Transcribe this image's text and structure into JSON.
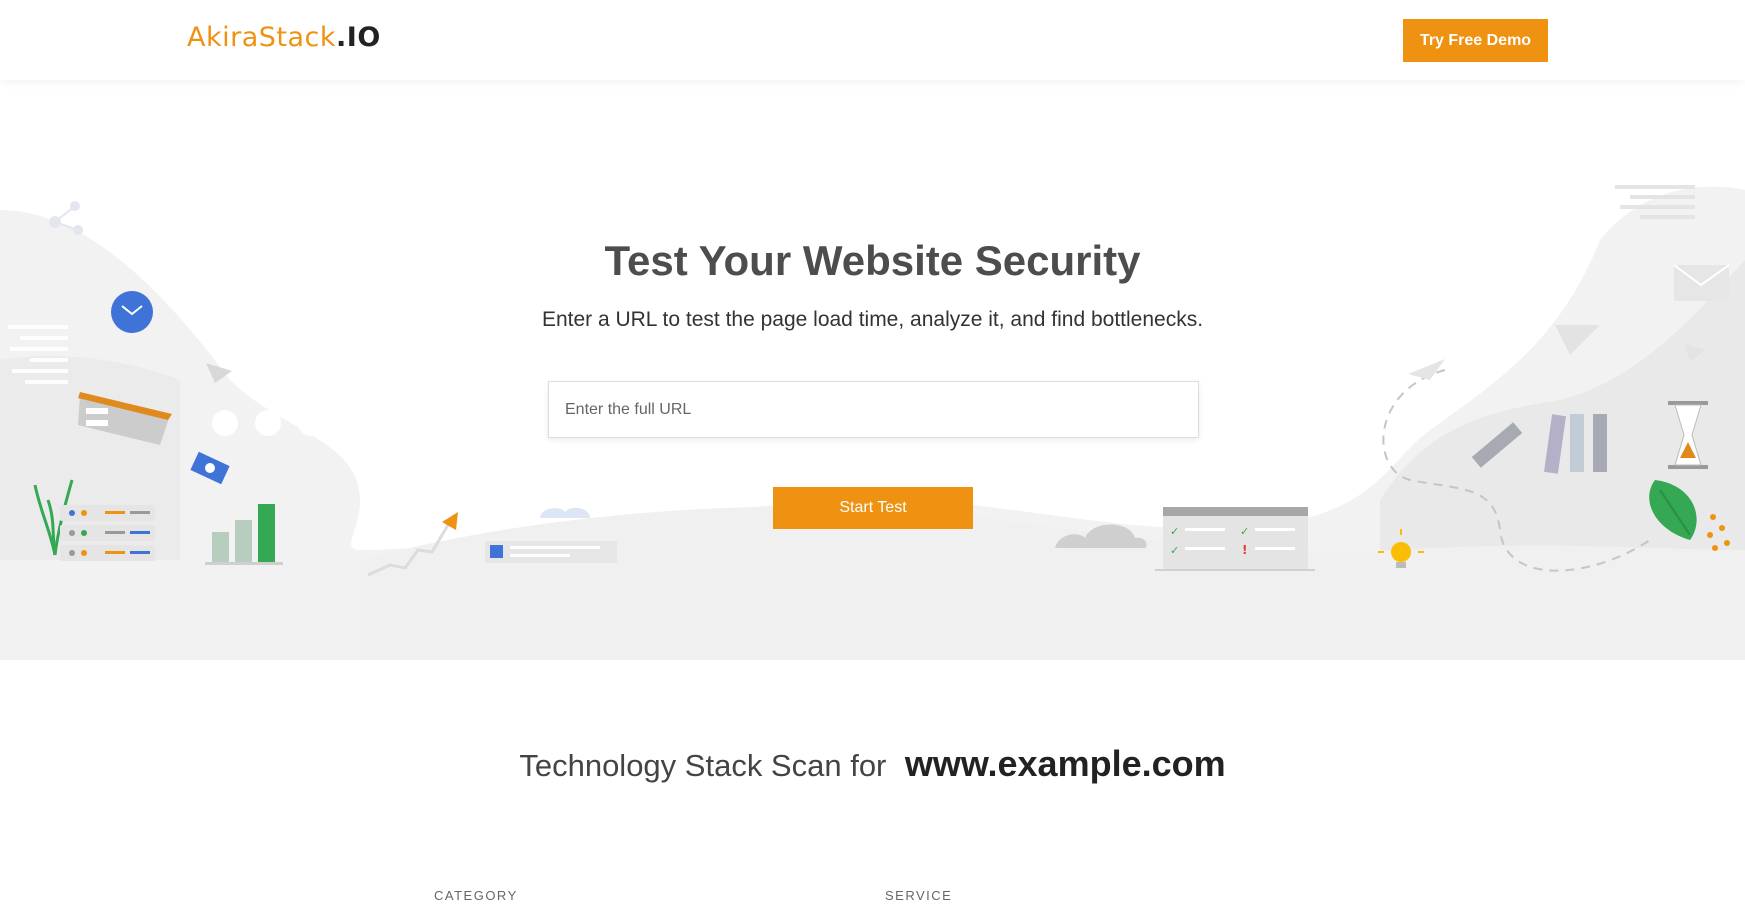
{
  "header": {
    "logo_brand": "AkiraStack",
    "logo_tld": ".IO",
    "demo_button": "Try Free Demo"
  },
  "hero": {
    "title": "Test Your Website Security",
    "subtitle": "Enter a URL to test the page load time, analyze it, and find bottlenecks.",
    "url_placeholder": "Enter the full URL",
    "url_value": "",
    "start_button": "Start Test",
    "illustration_icons": [
      "mail-icon",
      "paper-plane-icon",
      "hourglass-icon",
      "lightbulb-icon",
      "leaf-icon",
      "cloud-icon",
      "bar-chart-icon",
      "checklist-icon",
      "books-icon",
      "camera-icon",
      "arrow-up-icon"
    ]
  },
  "scan": {
    "prefix": "Technology Stack Scan for",
    "domain": "www.example.com",
    "columns": [
      "CATEGORY",
      "SERVICE"
    ]
  },
  "colors": {
    "accent": "#ef9211",
    "background_wave": "#f2f2f2"
  }
}
